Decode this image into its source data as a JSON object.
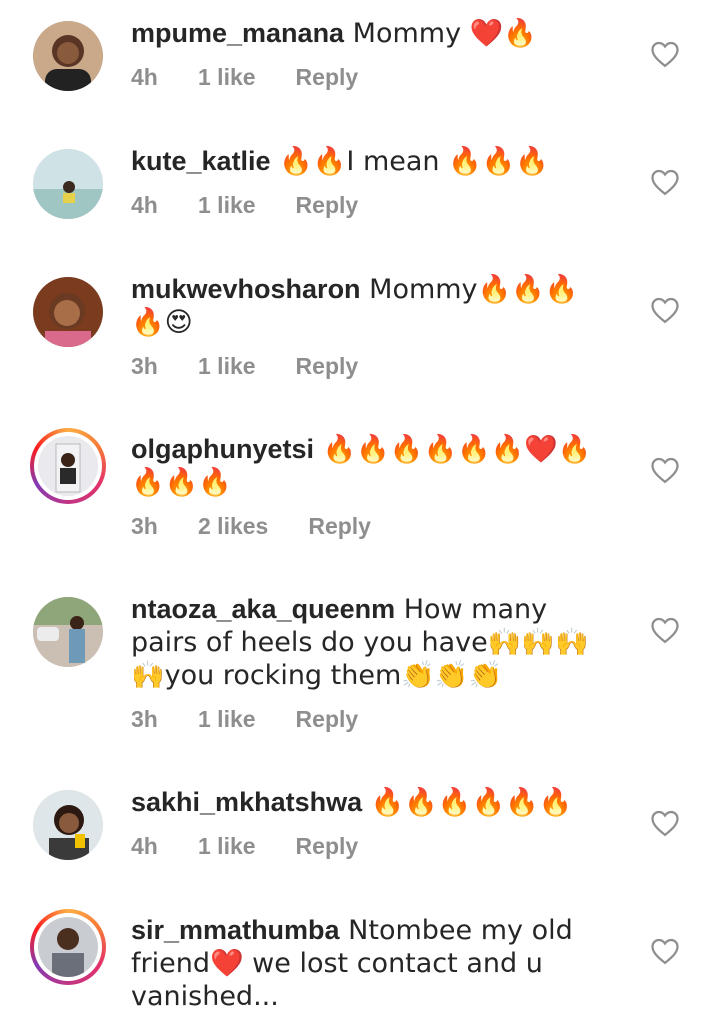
{
  "comments": [
    {
      "username": "mpume_manana",
      "text": " Mommy ❤️🔥",
      "time": "4h",
      "likes": "1 like",
      "reply": "Reply",
      "story_ring": false
    },
    {
      "username": "kute_katlie",
      "text": " 🔥🔥I mean 🔥🔥🔥",
      "time": "4h",
      "likes": "1 like",
      "reply": "Reply",
      "story_ring": false
    },
    {
      "username": "mukwevhosharon",
      "text": " Mommy🔥🔥🔥🔥😍",
      "time": "3h",
      "likes": "1 like",
      "reply": "Reply",
      "story_ring": false
    },
    {
      "username": "olgaphunyetsi",
      "text": " 🔥🔥🔥🔥🔥🔥❤️🔥🔥🔥🔥",
      "time": "3h",
      "likes": "2 likes",
      "reply": "Reply",
      "story_ring": true
    },
    {
      "username": "ntaoza_aka_queenm",
      "text": " How many pairs of heels do you have🙌🙌🙌🙌you rocking them👏👏👏",
      "time": "3h",
      "likes": "1 like",
      "reply": "Reply",
      "story_ring": false
    },
    {
      "username": "sakhi_mkhatshwa",
      "text": " 🔥🔥🔥🔥🔥🔥",
      "time": "4h",
      "likes": "1 like",
      "reply": "Reply",
      "story_ring": false
    },
    {
      "username": "sir_mmathumba",
      "text": " Ntombee my old friend❤️ we lost contact and u vanished...",
      "time": "",
      "likes": "",
      "reply": "",
      "story_ring": true
    }
  ],
  "colors": {
    "text": "#262626",
    "meta": "#8e8e8e",
    "heart_outline": "#8e8e8e"
  },
  "icons": {
    "like_button": "heart-outline-icon"
  }
}
